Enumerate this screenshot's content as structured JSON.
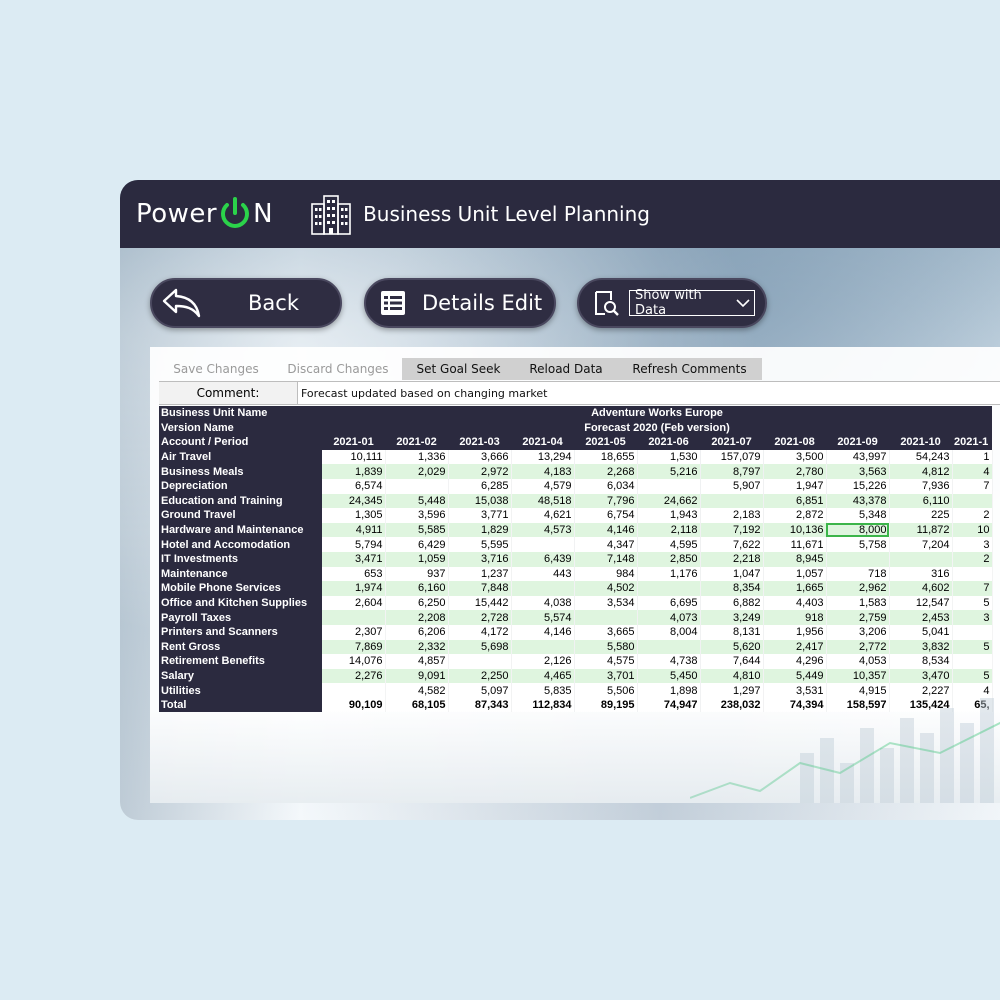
{
  "header": {
    "brand_left": "Power",
    "brand_right": "N",
    "title": "Business Unit Level Planning"
  },
  "buttons": {
    "back": "Back",
    "details_edit": "Details Edit",
    "show_select_value": "Show with Data"
  },
  "toolbar": {
    "save": "Save Changes",
    "discard": "Discard Changes",
    "goal_seek": "Set Goal Seek",
    "reload": "Reload Data",
    "refresh": "Refresh Comments"
  },
  "comment": {
    "label": "Comment:",
    "value": "Forecast updated based on changing market"
  },
  "grid": {
    "business_unit_label": "Business Unit Name",
    "business_unit_value": "Adventure Works Europe",
    "version_label": "Version Name",
    "version_value": "Forecast 2020 (Feb version)",
    "account_period_label": "Account  / Period",
    "periods": [
      "2021-01",
      "2021-02",
      "2021-03",
      "2021-04",
      "2021-05",
      "2021-06",
      "2021-07",
      "2021-08",
      "2021-09",
      "2021-10",
      "2021-1"
    ],
    "rows": [
      {
        "name": "Air Travel",
        "values": [
          "10,111",
          "1,336",
          "3,666",
          "13,294",
          "18,655",
          "1,530",
          "157,079",
          "3,500",
          "43,997",
          "54,243",
          "1"
        ]
      },
      {
        "name": "Business Meals",
        "values": [
          "1,839",
          "2,029",
          "2,972",
          "4,183",
          "2,268",
          "5,216",
          "8,797",
          "2,780",
          "3,563",
          "4,812",
          "4"
        ]
      },
      {
        "name": "Depreciation",
        "values": [
          "6,574",
          "",
          "6,285",
          "4,579",
          "6,034",
          "",
          "5,907",
          "1,947",
          "15,226",
          "7,936",
          "7"
        ]
      },
      {
        "name": "Education and Training",
        "values": [
          "24,345",
          "5,448",
          "15,038",
          "48,518",
          "7,796",
          "24,662",
          "",
          "6,851",
          "43,378",
          "6,110",
          ""
        ]
      },
      {
        "name": "Ground Travel",
        "values": [
          "1,305",
          "3,596",
          "3,771",
          "4,621",
          "6,754",
          "1,943",
          "2,183",
          "2,872",
          "5,348",
          "225",
          "2"
        ]
      },
      {
        "name": "Hardware and Maintenance",
        "values": [
          "4,911",
          "5,585",
          "1,829",
          "4,573",
          "4,146",
          "2,118",
          "7,192",
          "10,136",
          "8,000",
          "11,872",
          "10"
        ]
      },
      {
        "name": "Hotel and Accomodation",
        "values": [
          "5,794",
          "6,429",
          "5,595",
          "",
          "4,347",
          "4,595",
          "7,622",
          "11,671",
          "5,758",
          "7,204",
          "3"
        ]
      },
      {
        "name": "IT Investments",
        "values": [
          "3,471",
          "1,059",
          "3,716",
          "6,439",
          "7,148",
          "2,850",
          "2,218",
          "8,945",
          "",
          "",
          "2"
        ]
      },
      {
        "name": "Maintenance",
        "values": [
          "653",
          "937",
          "1,237",
          "443",
          "984",
          "1,176",
          "1,047",
          "1,057",
          "718",
          "316",
          ""
        ]
      },
      {
        "name": "Mobile Phone Services",
        "values": [
          "1,974",
          "6,160",
          "7,848",
          "",
          "4,502",
          "",
          "8,354",
          "1,665",
          "2,962",
          "4,602",
          "7"
        ]
      },
      {
        "name": "Office and Kitchen Supplies",
        "values": [
          "2,604",
          "6,250",
          "15,442",
          "4,038",
          "3,534",
          "6,695",
          "6,882",
          "4,403",
          "1,583",
          "12,547",
          "5"
        ]
      },
      {
        "name": "Payroll Taxes",
        "values": [
          "",
          "2,208",
          "2,728",
          "5,574",
          "",
          "4,073",
          "3,249",
          "918",
          "2,759",
          "2,453",
          "3"
        ]
      },
      {
        "name": "Printers and Scanners",
        "values": [
          "2,307",
          "6,206",
          "4,172",
          "4,146",
          "3,665",
          "8,004",
          "8,131",
          "1,956",
          "3,206",
          "5,041",
          ""
        ]
      },
      {
        "name": "Rent Gross",
        "values": [
          "7,869",
          "2,332",
          "5,698",
          "",
          "5,580",
          "",
          "5,620",
          "2,417",
          "2,772",
          "3,832",
          "5"
        ]
      },
      {
        "name": "Retirement Benefits",
        "values": [
          "14,076",
          "4,857",
          "",
          "2,126",
          "4,575",
          "4,738",
          "7,644",
          "4,296",
          "4,053",
          "8,534",
          ""
        ]
      },
      {
        "name": "Salary",
        "values": [
          "2,276",
          "9,091",
          "2,250",
          "4,465",
          "3,701",
          "5,450",
          "4,810",
          "5,449",
          "10,357",
          "3,470",
          "5"
        ]
      },
      {
        "name": "Utilities",
        "values": [
          "",
          "4,582",
          "5,097",
          "5,835",
          "5,506",
          "1,898",
          "1,297",
          "3,531",
          "4,915",
          "2,227",
          "4"
        ]
      }
    ],
    "total": {
      "name": "Total",
      "values": [
        "90,109",
        "68,105",
        "87,343",
        "112,834",
        "89,195",
        "74,947",
        "238,032",
        "74,394",
        "158,597",
        "135,424",
        "65,"
      ]
    }
  },
  "colors": {
    "dark": "#2b2a3f",
    "power_green": "#2bd24a",
    "row_green": "#dff5df",
    "selected_cell": "#3cb54a"
  }
}
